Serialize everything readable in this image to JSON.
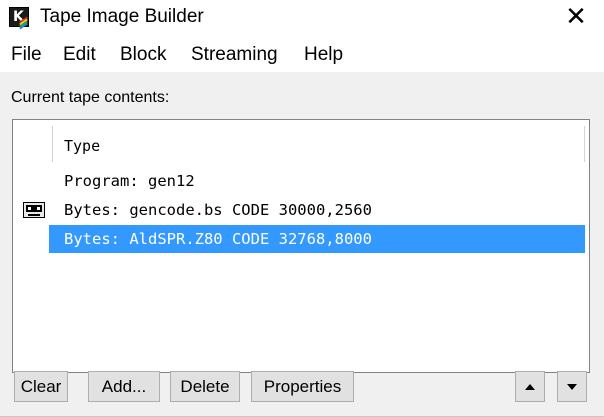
{
  "window": {
    "title": "Tape Image Builder",
    "close_glyph": "✕"
  },
  "menu": [
    "File",
    "Edit",
    "Block",
    "Streaming",
    "Help"
  ],
  "tape_label": "Current tape contents:",
  "list": {
    "column_header": "Type",
    "rows": [
      {
        "text": "Program: gen12",
        "selected": false,
        "icon": null
      },
      {
        "text": "Bytes: gencode.bs CODE 30000,2560",
        "selected": false,
        "icon": "cassette-icon"
      },
      {
        "text": "Bytes: AldSPR.Z80 CODE 32768,8000",
        "selected": true,
        "icon": null
      }
    ]
  },
  "buttons": {
    "clear": "Clear",
    "add": "Add...",
    "delete": "Delete",
    "properties": "Properties"
  },
  "colors": {
    "selection": "#3399ff",
    "window_bg": "#f0f0f0"
  }
}
